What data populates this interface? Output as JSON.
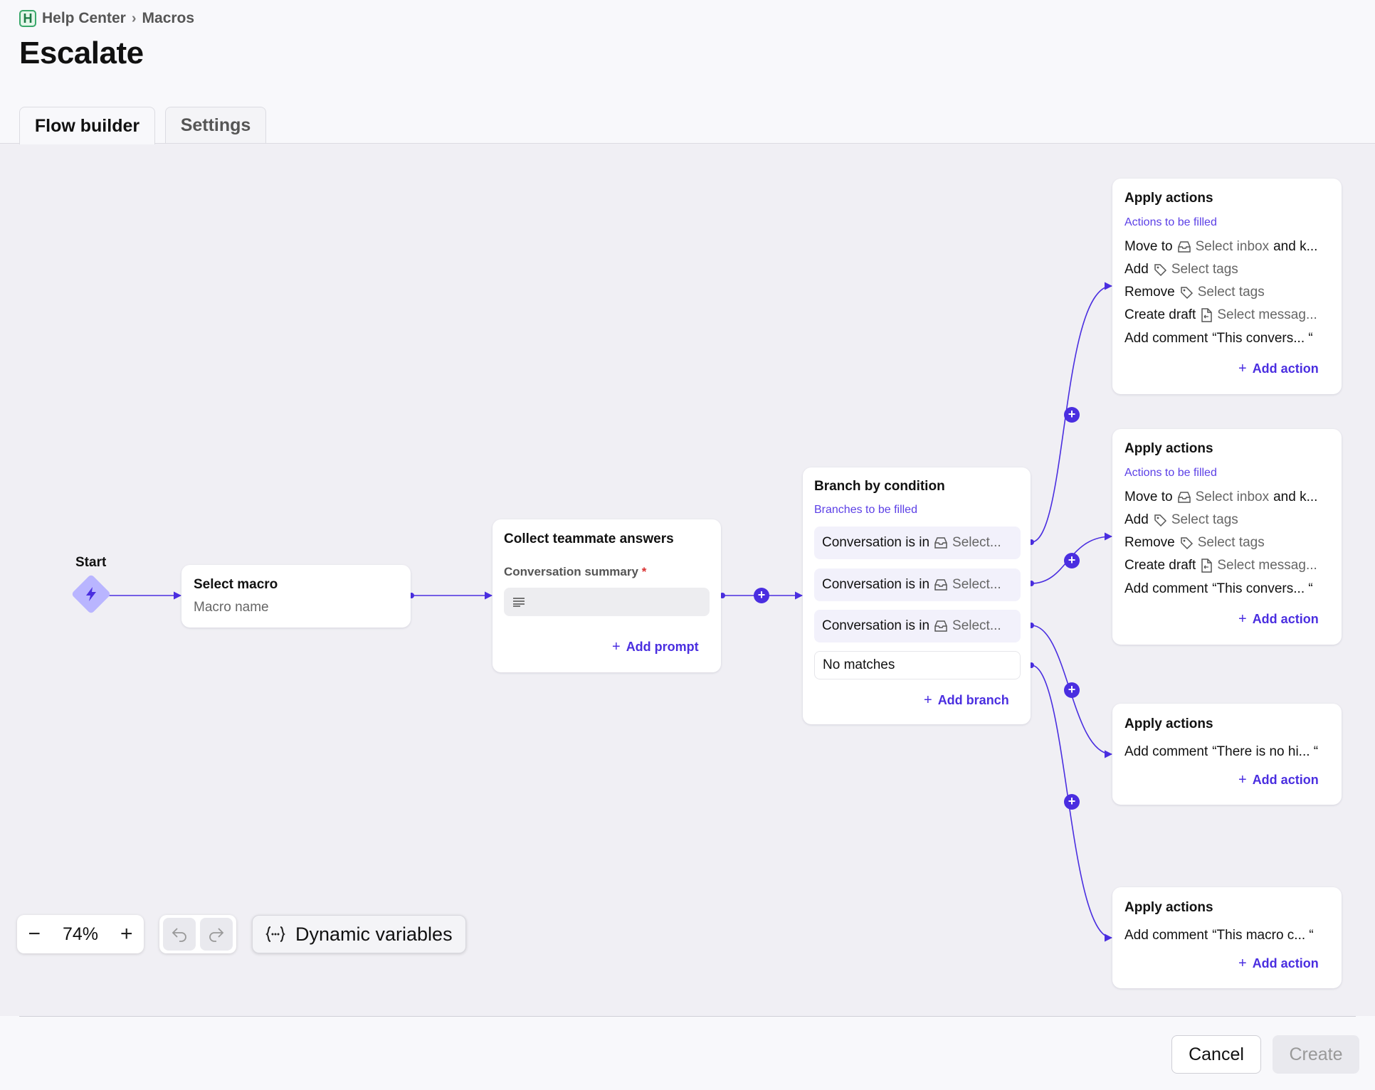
{
  "breadcrumb": {
    "root": "Help Center",
    "current": "Macros",
    "logo_letter": "H"
  },
  "page_title": "Escalate",
  "tabs": [
    {
      "label": "Flow builder",
      "active": true
    },
    {
      "label": "Settings",
      "active": false
    }
  ],
  "colors": {
    "accent": "#4a2ee0",
    "start_diamond": "#b9b5ff",
    "canvas_bg": "#f0eff4"
  },
  "flow": {
    "start": {
      "label": "Start",
      "icon": "lightning-icon"
    },
    "select_macro": {
      "title": "Select macro",
      "placeholder": "Macro name"
    },
    "collect": {
      "title": "Collect teammate answers",
      "field_label": "Conversation summary",
      "required_mark": "*",
      "add_label": "Add prompt"
    },
    "branch": {
      "title": "Branch by condition",
      "subtitle": "Branches to be filled",
      "conditions": [
        {
          "text": "Conversation is in",
          "value": "Select..."
        },
        {
          "text": "Conversation is in",
          "value": "Select..."
        },
        {
          "text": "Conversation is in",
          "value": "Select..."
        }
      ],
      "no_match": "No matches",
      "add_label": "Add branch"
    },
    "actions": [
      {
        "title": "Apply actions",
        "subtitle": "Actions to be filled",
        "lines": [
          {
            "verb": "Move to",
            "value": "Select inbox",
            "extra": "and k...",
            "icon": "inbox-icon"
          },
          {
            "verb": "Add",
            "value": "Select tags",
            "icon": "tag-icon"
          },
          {
            "verb": "Remove",
            "value": "Select tags",
            "icon": "tag-icon"
          },
          {
            "verb": "Create draft",
            "value": "Select messag...",
            "icon": "message-template-icon"
          },
          {
            "verb": "Add comment",
            "value": "“This convers... “"
          }
        ],
        "add_label": "Add action"
      },
      {
        "title": "Apply actions",
        "subtitle": "Actions to be filled",
        "lines": [
          {
            "verb": "Move to",
            "value": "Select inbox",
            "extra": "and k...",
            "icon": "inbox-icon"
          },
          {
            "verb": "Add",
            "value": "Select tags",
            "icon": "tag-icon"
          },
          {
            "verb": "Remove",
            "value": "Select tags",
            "icon": "tag-icon"
          },
          {
            "verb": "Create draft",
            "value": "Select messag...",
            "icon": "message-template-icon"
          },
          {
            "verb": "Add comment",
            "value": "“This convers... “"
          }
        ],
        "add_label": "Add action"
      },
      {
        "title": "Apply actions",
        "lines": [
          {
            "verb": "Add comment",
            "value": "“There is no hi... “"
          }
        ],
        "add_label": "Add action"
      },
      {
        "title": "Apply actions",
        "lines": [
          {
            "verb": "Add comment",
            "value": "“This macro c... “"
          }
        ],
        "add_label": "Add action"
      }
    ],
    "plus_symbol": "+"
  },
  "toolbar": {
    "zoom": "74%",
    "zoom_out": "−",
    "zoom_in": "+",
    "dynamic_variables": "Dynamic variables"
  },
  "footer": {
    "cancel": "Cancel",
    "create": "Create"
  }
}
